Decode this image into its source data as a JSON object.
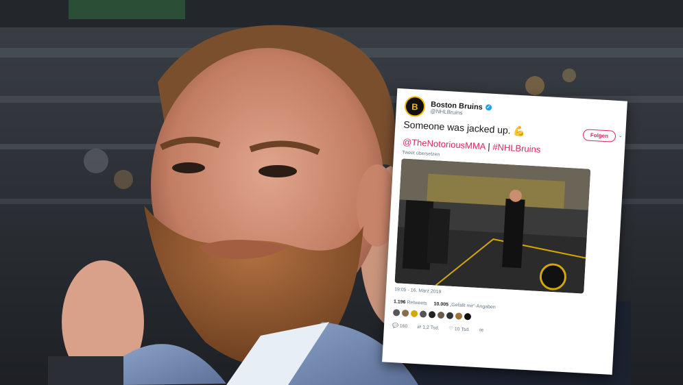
{
  "tweet": {
    "account_name": "Boston Bruins",
    "handle": "@NHLBruins",
    "follow_label": "Folgen",
    "text": "Someone was jacked up.",
    "emoji": "💪",
    "mention": "@TheNotoriousMMA",
    "separator": "|",
    "hashtag": "#NHLBruins",
    "translate_label": "Tweet übersetzen",
    "timestamp": "19:05 - 16. März 2019",
    "retweets_count": "1.196",
    "retweets_label": "Retweets",
    "likes_count": "10.005",
    "likes_label": "„Gefällt mir“-Angaben",
    "reply_count": "160",
    "retweet_action_count": "1,2 Tsd.",
    "like_action_count": "10 Tsd."
  },
  "colors": {
    "accent": "#e0245e",
    "bruins_gold": "#f5b700"
  }
}
